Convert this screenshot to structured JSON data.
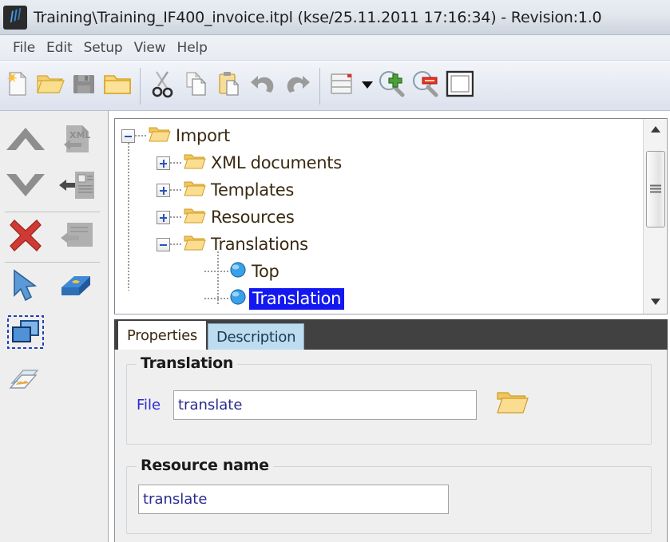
{
  "window": {
    "title": "Training\\Training_IF400_invoice.itpl (kse/25.11.2011 17:16:34) - Revision:1.0",
    "app_icon": "app-logo-icon"
  },
  "menubar": {
    "items": [
      {
        "label": "File"
      },
      {
        "label": "Edit"
      },
      {
        "label": "Setup"
      },
      {
        "label": "View"
      },
      {
        "label": "Help"
      }
    ]
  },
  "toolbar": {
    "buttons": [
      {
        "name": "new-document-button",
        "icon": "new-document-icon",
        "tooltip": "New"
      },
      {
        "name": "open-folder-button",
        "icon": "open-folder-icon",
        "tooltip": "Open"
      },
      {
        "name": "save-button",
        "icon": "floppy-disk-icon",
        "tooltip": "Save"
      },
      {
        "name": "folder-button",
        "icon": "folder-icon",
        "tooltip": "Folder"
      },
      {
        "name": "cut-button",
        "icon": "scissors-icon",
        "tooltip": "Cut"
      },
      {
        "name": "copy-button",
        "icon": "copy-pages-icon",
        "tooltip": "Copy"
      },
      {
        "name": "paste-button",
        "icon": "clipboard-paste-icon",
        "tooltip": "Paste"
      },
      {
        "name": "undo-button",
        "icon": "undo-arrow-icon",
        "tooltip": "Undo"
      },
      {
        "name": "redo-button",
        "icon": "redo-arrow-icon",
        "tooltip": "Redo"
      },
      {
        "name": "layout-list-button",
        "icon": "list-window-icon",
        "tooltip": "Layout"
      },
      {
        "name": "zoom-in-button",
        "icon": "magnifier-plus-icon",
        "tooltip": "Zoom in"
      },
      {
        "name": "zoom-out-button",
        "icon": "magnifier-minus-icon",
        "tooltip": "Zoom out"
      },
      {
        "name": "page-view-button",
        "icon": "page-frame-icon",
        "tooltip": "Page view"
      }
    ]
  },
  "sidebar": {
    "buttons": [
      {
        "name": "move-up-button",
        "icon": "chevron-up-icon",
        "enabled": true
      },
      {
        "name": "import-xml-button",
        "icon": "xml-import-icon",
        "enabled": false
      },
      {
        "name": "move-down-button",
        "icon": "chevron-down-icon",
        "enabled": true
      },
      {
        "name": "import-data-button",
        "icon": "data-import-arrow-icon",
        "enabled": false
      },
      {
        "name": "delete-button",
        "icon": "red-cross-icon",
        "enabled": true
      },
      {
        "name": "import-template-button",
        "icon": "template-import-icon",
        "enabled": false
      },
      {
        "name": "select-pointer-button",
        "icon": "mouse-pointer-icon",
        "enabled": true
      },
      {
        "name": "dictionary-button",
        "icon": "blue-book-icon",
        "enabled": true
      },
      {
        "name": "duplicate-window-button",
        "icon": "duplicate-windows-icon",
        "enabled": true,
        "selected": true
      },
      {
        "name": "preview-button",
        "icon": "print-preview-icon",
        "enabled": true
      }
    ]
  },
  "tree": {
    "nodes": [
      {
        "label": "Import",
        "level": 0,
        "expander": "minus",
        "icon": "open-folder-icon",
        "selected": false
      },
      {
        "label": "XML documents",
        "level": 1,
        "expander": "plus",
        "icon": "open-folder-icon",
        "selected": false
      },
      {
        "label": "Templates",
        "level": 1,
        "expander": "plus",
        "icon": "open-folder-icon",
        "selected": false
      },
      {
        "label": "Resources",
        "level": 1,
        "expander": "plus",
        "icon": "open-folder-icon",
        "selected": false
      },
      {
        "label": "Translations",
        "level": 1,
        "expander": "minus",
        "icon": "open-folder-icon",
        "selected": false
      },
      {
        "label": "Top",
        "level": 2,
        "expander": "none",
        "icon": "blue-sphere-icon",
        "selected": false
      },
      {
        "label": "Translation",
        "level": 2,
        "expander": "none",
        "icon": "blue-sphere-icon",
        "selected": true
      }
    ],
    "scrollbar": {
      "up_arrow": "scroll-up-arrow-icon",
      "down_arrow": "scroll-down-arrow-icon"
    }
  },
  "tabs": [
    {
      "label": "Properties",
      "active": true
    },
    {
      "label": "Description",
      "active": false
    }
  ],
  "properties": {
    "translation_group": {
      "title": "Translation",
      "file_label": "File",
      "file_value": "translate",
      "browse_icon": "open-folder-icon"
    },
    "resource_group": {
      "title": "Resource name",
      "name_value": "translate"
    }
  },
  "colors": {
    "selection_blue": "#1318f0",
    "tabstrip_dark": "#414141",
    "active_tab_bg": "#ffffff",
    "inactive_tab_bg": "#bddcf0",
    "folder_yellow": "#f5c84c",
    "label_blue": "#2b2bd8",
    "panel_gray": "#efefef"
  }
}
